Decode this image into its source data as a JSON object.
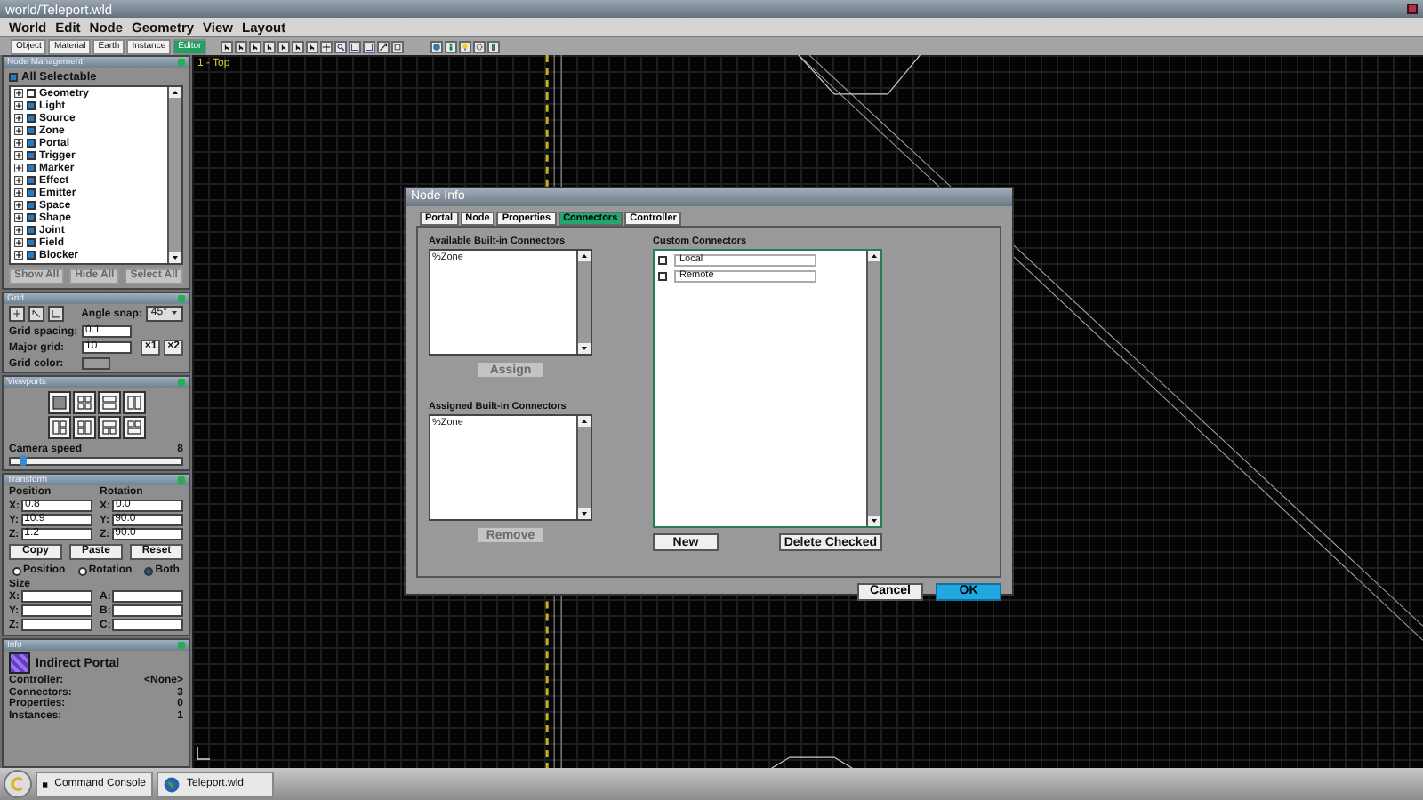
{
  "window": {
    "title": "world/Teleport.wld"
  },
  "menu": [
    "World",
    "Edit",
    "Node",
    "Geometry",
    "View",
    "Layout"
  ],
  "mode_tabs": [
    {
      "label": "Object",
      "selected": false
    },
    {
      "label": "Material",
      "selected": false
    },
    {
      "label": "Earth",
      "selected": false
    },
    {
      "label": "Instance",
      "selected": false
    },
    {
      "label": "Editor",
      "selected": true
    }
  ],
  "node_management": {
    "title": "Node Management",
    "all_selectable": {
      "label": "All Selectable",
      "checked": true
    },
    "items": [
      {
        "label": "Geometry",
        "checked": false
      },
      {
        "label": "Light",
        "checked": true
      },
      {
        "label": "Source",
        "checked": true
      },
      {
        "label": "Zone",
        "checked": true
      },
      {
        "label": "Portal",
        "checked": true
      },
      {
        "label": "Trigger",
        "checked": true
      },
      {
        "label": "Marker",
        "checked": true
      },
      {
        "label": "Effect",
        "checked": true
      },
      {
        "label": "Emitter",
        "checked": true
      },
      {
        "label": "Space",
        "checked": true
      },
      {
        "label": "Shape",
        "checked": true
      },
      {
        "label": "Joint",
        "checked": true
      },
      {
        "label": "Field",
        "checked": true
      },
      {
        "label": "Blocker",
        "checked": true
      }
    ],
    "buttons": [
      {
        "label": "Show All",
        "disabled": true
      },
      {
        "label": "Hide All",
        "disabled": true
      },
      {
        "label": "Select All",
        "disabled": true
      }
    ]
  },
  "grid": {
    "title": "Grid",
    "angle_snap": {
      "label": "Angle snap:",
      "value": "45°"
    },
    "fields": [
      {
        "label": "Grid spacing:",
        "value": "0.1"
      },
      {
        "label": "Major grid:",
        "value": "10"
      }
    ],
    "color_label": "Grid color:",
    "buttons": [
      "×1",
      "×2"
    ]
  },
  "viewports": {
    "title": "Viewports",
    "camera_speed": {
      "label": "Camera speed",
      "reading": "8",
      "level": 0.05
    }
  },
  "transform": {
    "title": "Transform",
    "position_label": "Position",
    "rotation_label": "Rotation",
    "position": [
      {
        "axis": "X:",
        "value": "0.8"
      },
      {
        "axis": "Y:",
        "value": "10.9"
      },
      {
        "axis": "Z:",
        "value": "1.2"
      }
    ],
    "rotation": [
      {
        "axis": "X:",
        "value": "0.0"
      },
      {
        "axis": "Y:",
        "value": "90.0"
      },
      {
        "axis": "Z:",
        "value": "90.0"
      }
    ],
    "buttons": [
      "Copy",
      "Paste",
      "Reset"
    ],
    "modes": [
      {
        "label": "Position",
        "selected": false
      },
      {
        "label": "Rotation",
        "selected": false
      },
      {
        "label": "Both",
        "selected": true
      }
    ],
    "size_label": "Size",
    "size_left": [
      "X:",
      "Y:",
      "Z:"
    ],
    "size_right": [
      "A:",
      "B:",
      "C:"
    ]
  },
  "info": {
    "title": "Info",
    "name": "Indirect Portal",
    "rows": [
      {
        "label": "Controller:",
        "value": "<None>"
      },
      {
        "label": "Connectors:",
        "value": "3"
      },
      {
        "label": "Properties:",
        "value": "0"
      },
      {
        "label": "Instances:",
        "value": "1"
      }
    ]
  },
  "viewport": {
    "label": "1 - Top"
  },
  "dialog": {
    "title": "Node Info",
    "tabs": [
      {
        "label": "Portal",
        "selected": false
      },
      {
        "label": "Node",
        "selected": false
      },
      {
        "label": "Properties",
        "selected": false
      },
      {
        "label": "Connectors",
        "selected": true
      },
      {
        "label": "Controller",
        "selected": false
      }
    ],
    "available": {
      "label": "Available Built-in Connectors",
      "items": [
        "%Zone"
      ],
      "button": {
        "label": "Assign",
        "disabled": true
      }
    },
    "assigned": {
      "label": "Assigned Built-in Connectors",
      "items": [
        "%Zone"
      ],
      "button": {
        "label": "Remove",
        "disabled": true
      }
    },
    "custom": {
      "label": "Custom Connectors",
      "items": [
        {
          "name": "Local",
          "checked": false
        },
        {
          "name": "Remote",
          "checked": false
        }
      ],
      "buttons": [
        "New",
        "Delete Checked"
      ]
    },
    "footer_buttons": [
      {
        "label": "Cancel",
        "kind": "default"
      },
      {
        "label": "OK",
        "kind": "primary"
      }
    ]
  },
  "taskbar": {
    "items": [
      {
        "label": "Command Console",
        "kind": "console"
      },
      {
        "label": "Teleport.wld",
        "kind": "world"
      }
    ]
  }
}
